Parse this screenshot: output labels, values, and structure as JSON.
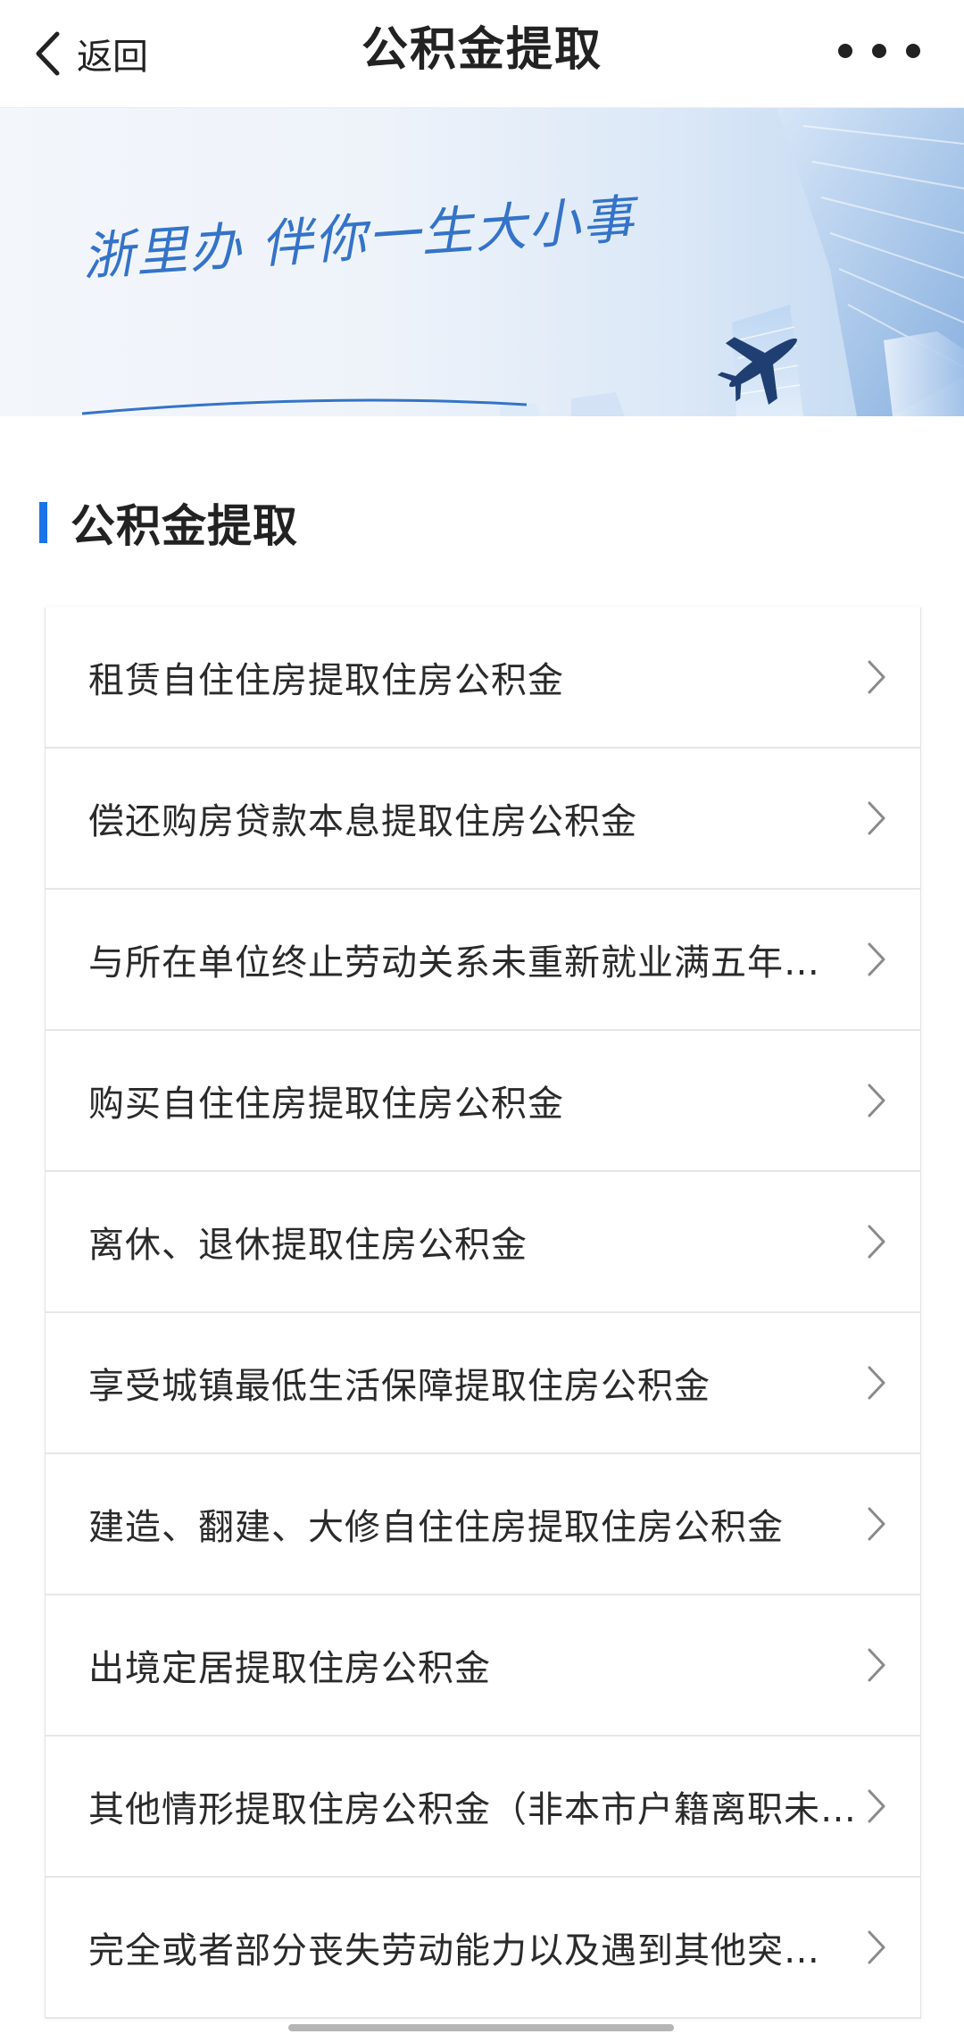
{
  "header": {
    "back_label": "返回",
    "title": "公积金提取",
    "back_icon": "chevron-left-icon",
    "more_icon": "more-dots-icon"
  },
  "banner": {
    "slogan": "浙里办 伴你一生大小事",
    "illustration": "airplane-and-skyscrapers"
  },
  "section": {
    "title": "公积金提取",
    "accent_color": "#1a73e8"
  },
  "services": [
    {
      "label": "租赁自住住房提取住房公积金"
    },
    {
      "label": "偿还购房贷款本息提取住房公积金"
    },
    {
      "label": "与所在单位终止劳动关系未重新就业满五年…"
    },
    {
      "label": "购买自住住房提取住房公积金"
    },
    {
      "label": "离休、退休提取住房公积金"
    },
    {
      "label": "享受城镇最低生活保障提取住房公积金"
    },
    {
      "label": "建造、翻建、大修自住住房提取住房公积金"
    },
    {
      "label": "出境定居提取住房公积金"
    },
    {
      "label": "其他情形提取住房公积金（非本市户籍离职未…"
    },
    {
      "label": "完全或者部分丧失劳动能力以及遇到其他突…"
    }
  ],
  "colors": {
    "accent": "#1a73e8",
    "text": "#222222",
    "divider": "#e6e6e6"
  }
}
